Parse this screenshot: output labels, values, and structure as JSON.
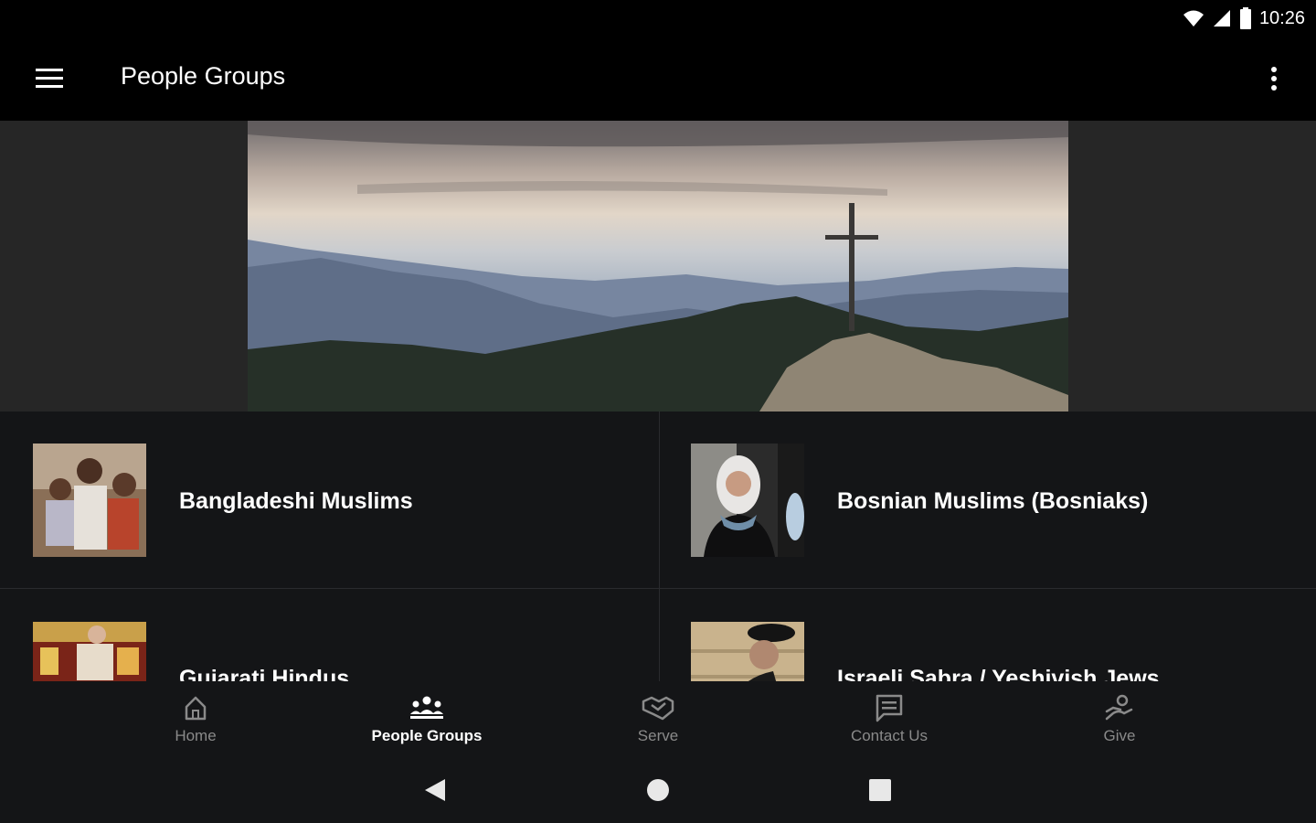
{
  "status_bar": {
    "time": "10:26",
    "icons": [
      "wifi-icon",
      "signal-icon",
      "battery-icon"
    ]
  },
  "app_bar": {
    "title": "People Groups",
    "menu_icon": "hamburger-menu-icon",
    "overflow_icon": "more-vertical-icon"
  },
  "hero": {
    "image": "mountain-cross-landscape"
  },
  "groups": [
    {
      "name": "Bangladeshi Muslims"
    },
    {
      "name": "Bosnian Muslims (Bosniaks)"
    },
    {
      "name": "Gujarati Hindus"
    },
    {
      "name": "Israeli Sabra / Yeshivish Jews"
    }
  ],
  "bottom_nav": {
    "active": "People Groups",
    "items": [
      {
        "label": "Home",
        "icon": "home-icon"
      },
      {
        "label": "People Groups",
        "icon": "people-groups-icon"
      },
      {
        "label": "Serve",
        "icon": "serve-icon"
      },
      {
        "label": "Contact Us",
        "icon": "contact-icon"
      },
      {
        "label": "Give",
        "icon": "give-icon"
      }
    ]
  },
  "system_nav": {
    "buttons": [
      "back-icon",
      "home-circle-icon",
      "recents-icon"
    ]
  },
  "colors": {
    "background": "#000000",
    "list_background": "#141517",
    "hero_background": "#262626",
    "inactive_label": "#8a8a8a",
    "active_label": "#ffffff"
  }
}
